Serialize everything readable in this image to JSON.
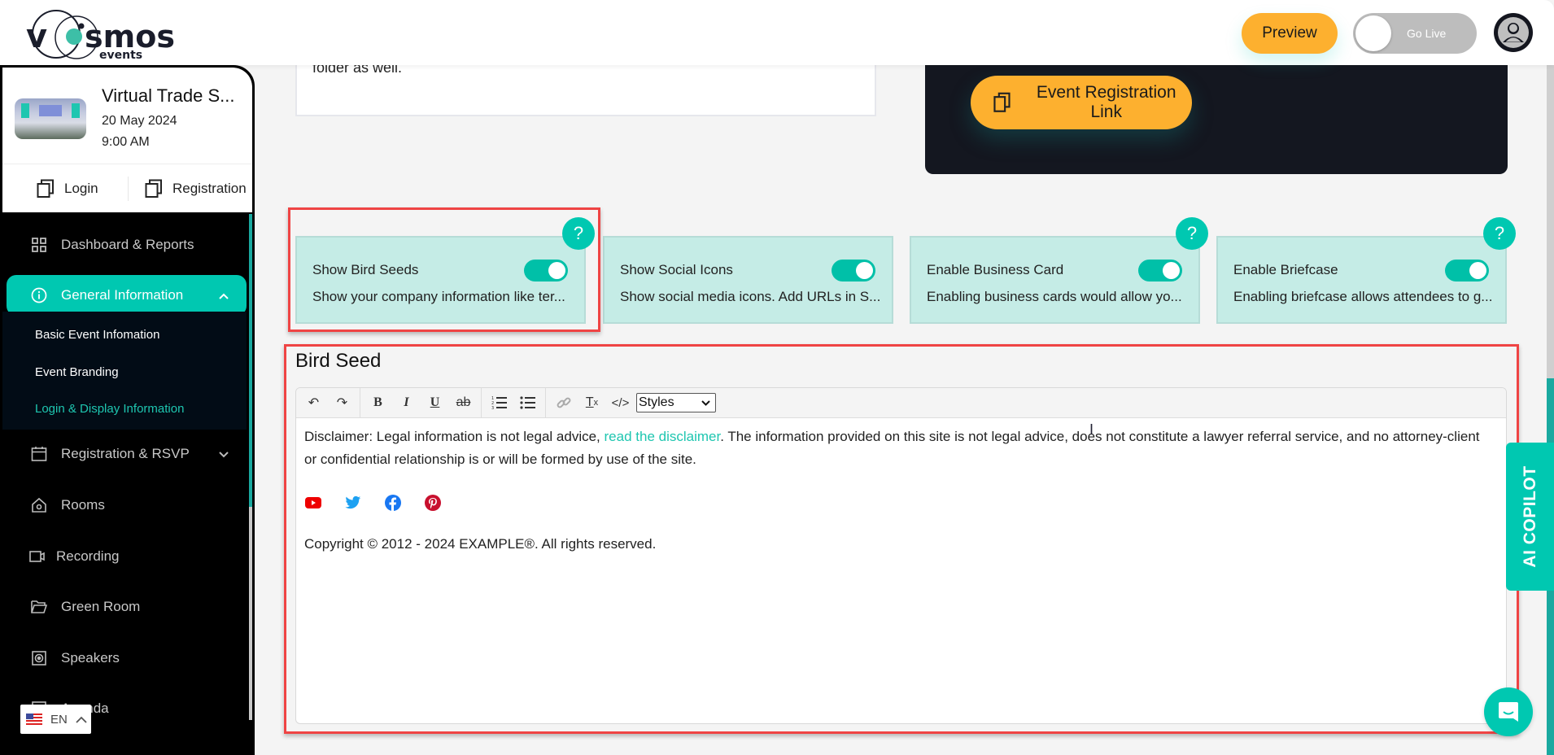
{
  "header": {
    "logo_text": "vosmos",
    "logo_sub": "events",
    "preview_label": "Preview",
    "go_live_label": "Go Live",
    "go_live_on": false
  },
  "event": {
    "title": "Virtual Trade S...",
    "date": "20 May 2024",
    "time": "9:00 AM",
    "login_label": "Login",
    "registration_label": "Registration"
  },
  "sidebar": {
    "items": [
      {
        "label": "Dashboard & Reports",
        "icon": "grid-icon"
      },
      {
        "label": "General Information",
        "icon": "info-icon",
        "expanded": true
      },
      {
        "label": "Registration & RSVP",
        "icon": "calendar-icon"
      },
      {
        "label": "Rooms",
        "icon": "home-icon"
      },
      {
        "label": "Recording",
        "icon": "video-icon"
      },
      {
        "label": "Green Room",
        "icon": "folder-icon"
      },
      {
        "label": "Speakers",
        "icon": "speaker-icon"
      },
      {
        "label": "Agenda",
        "icon": "agenda-icon"
      }
    ],
    "sub_items": [
      {
        "label": "Basic Event Infomation"
      },
      {
        "label": "Event Branding"
      },
      {
        "label": "Login & Display Information",
        "current": true
      }
    ],
    "language": "EN"
  },
  "main": {
    "info_text": "Please check your inbox, and if you can't find it, make sure to check your spam/junk folder as well.",
    "registration_link_label": "Event Registration Link",
    "features": [
      {
        "title": "Show Bird Seeds",
        "desc": "Show your company information like ter...",
        "enabled": true,
        "help": "?"
      },
      {
        "title": "Show Social Icons",
        "desc": "Show social media icons. Add URLs in S...",
        "enabled": true
      },
      {
        "title": "Enable Business Card",
        "desc": "Enabling business cards would allow yo...",
        "enabled": true,
        "help": "?"
      },
      {
        "title": "Enable Briefcase",
        "desc": "Enabling briefcase allows attendees to g...",
        "enabled": true,
        "help": "?"
      }
    ],
    "bird_seed": {
      "title": "Bird Seed",
      "styles_label": "Styles",
      "disclaimer_prefix": "Disclaimer: Legal information is not legal advice, ",
      "disclaimer_link": "read the disclaimer",
      "disclaimer_suffix": ". The information provided on this site is not legal advice, does not constitute a lawyer referral service, and no attorney-client or confidential relationship is or will be formed by use of the site.",
      "social_icons": [
        "youtube-icon",
        "twitter-icon",
        "facebook-icon",
        "pinterest-icon"
      ],
      "copyright": "Copyright © 2012 - 2024 EXAMPLE®. All rights reserved."
    },
    "ai_copilot_label": "AI COPILOT"
  },
  "colors": {
    "accent": "#00c8b1",
    "button_yellow": "#fdb02f",
    "sidebar_bg": "#000000",
    "highlight": "#ef4444"
  }
}
